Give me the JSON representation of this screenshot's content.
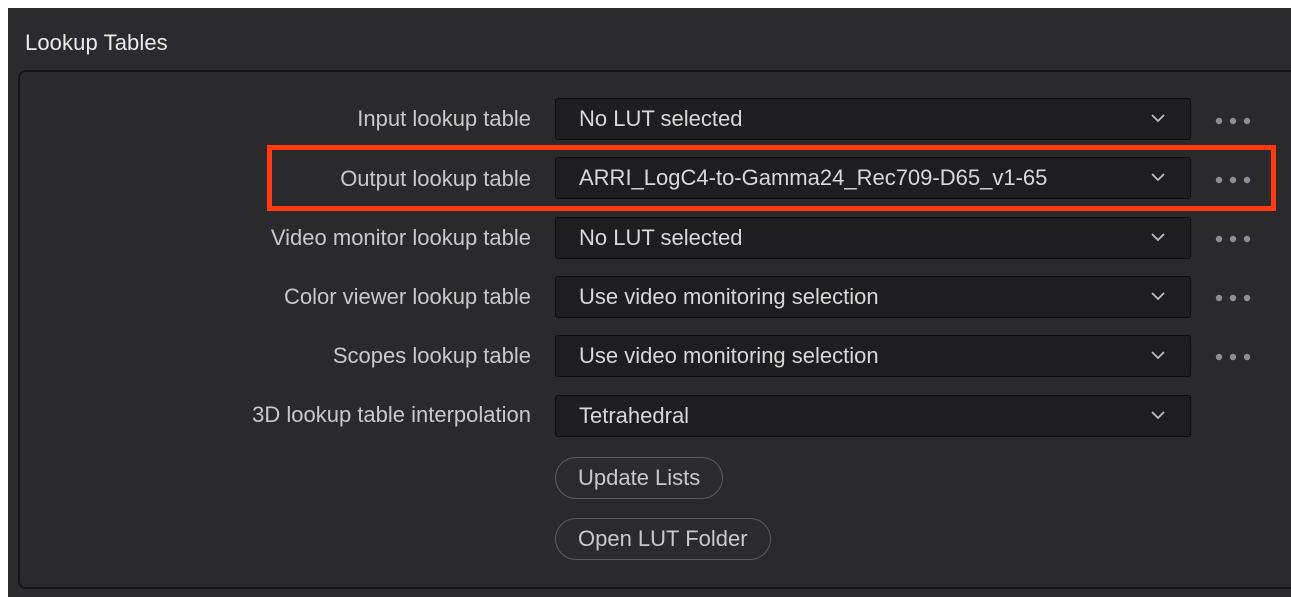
{
  "panel": {
    "title": "Lookup Tables"
  },
  "rows": [
    {
      "label": "Input lookup table",
      "value": "No LUT selected",
      "has_more": true
    },
    {
      "label": "Output lookup table",
      "value": "ARRI_LogC4-to-Gamma24_Rec709-D65_v1-65",
      "has_more": true
    },
    {
      "label": "Video monitor lookup table",
      "value": "No LUT selected",
      "has_more": true
    },
    {
      "label": "Color viewer lookup table",
      "value": "Use video monitoring selection",
      "has_more": true
    },
    {
      "label": "Scopes lookup table",
      "value": "Use video monitoring selection",
      "has_more": true
    },
    {
      "label": "3D lookup table interpolation",
      "value": "Tetrahedral",
      "has_more": false
    }
  ],
  "buttons": {
    "update_lists": "Update Lists",
    "open_lut_folder": "Open LUT Folder"
  },
  "icons": {
    "dropdown": "chevron-down-icon",
    "more": "more-options-icon"
  },
  "colors": {
    "highlight": "#ff3a10",
    "background": "#2b2b2d",
    "field": "#1e1e20"
  },
  "annotation": {
    "highlighted_row": "Output lookup table"
  }
}
